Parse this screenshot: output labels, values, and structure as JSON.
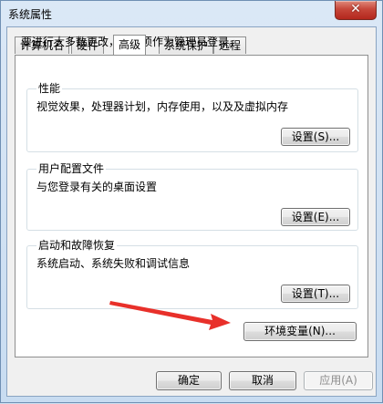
{
  "window": {
    "title": "系统属性",
    "close_symbol": "✕"
  },
  "tabs": [
    {
      "label": "计算机名"
    },
    {
      "label": "硬件"
    },
    {
      "label": "高级",
      "active": true
    },
    {
      "label": "系统保护"
    },
    {
      "label": "远程"
    }
  ],
  "advanced": {
    "intro": "要进行大多数更改，您必须作为管理员登录。",
    "performance": {
      "title": "性能",
      "description": "视觉效果，处理器计划，内存使用，以及及虚拟内存",
      "button": "设置(S)..."
    },
    "user_profiles": {
      "title": "用户配置文件",
      "description": "与您登录有关的桌面设置",
      "button": "设置(E)..."
    },
    "startup_recovery": {
      "title": "启动和故障恢复",
      "description": "系统启动、系统失败和调试信息",
      "button": "设置(T)..."
    },
    "env_button": "环境变量(N)..."
  },
  "footer": {
    "ok": "确定",
    "cancel": "取消",
    "apply": "应用(A)"
  },
  "colors": {
    "annotation_arrow": "#e8302a"
  }
}
